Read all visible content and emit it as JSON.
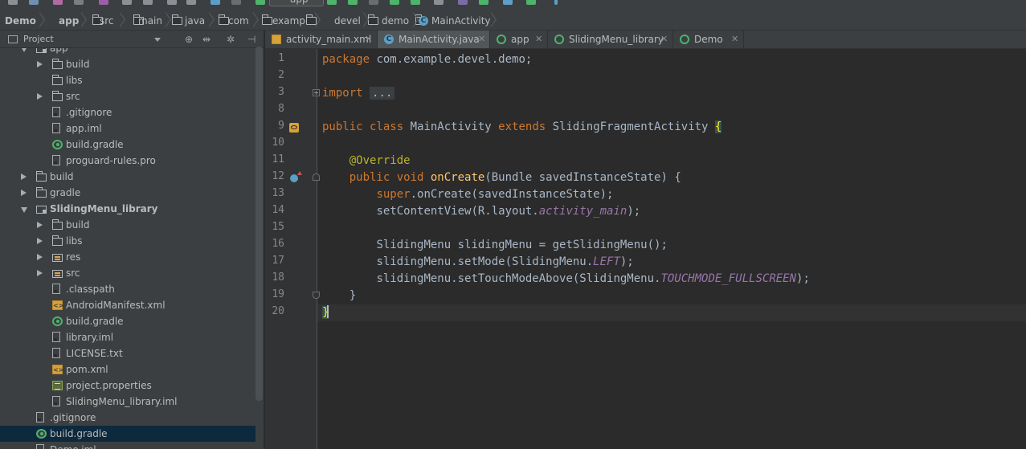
{
  "toolbar": {
    "run_config": "app"
  },
  "breadcrumbs": [
    "Demo",
    "app",
    "src",
    "main",
    "java",
    "com",
    "example",
    "devel",
    "demo",
    "MainActivity"
  ],
  "project_panel": {
    "title": "Project"
  },
  "tree": [
    {
      "label": "app",
      "type": "modfolder",
      "depth": 1,
      "arrow": "open"
    },
    {
      "label": "build",
      "type": "folder",
      "depth": 2,
      "arrow": "closed"
    },
    {
      "label": "libs",
      "type": "folder",
      "depth": 2,
      "arrow": "none"
    },
    {
      "label": "src",
      "type": "folder",
      "depth": 2,
      "arrow": "closed"
    },
    {
      "label": ".gitignore",
      "type": "file",
      "depth": 2,
      "arrow": "none"
    },
    {
      "label": "app.iml",
      "type": "file",
      "depth": 2,
      "arrow": "none"
    },
    {
      "label": "build.gradle",
      "type": "gradle",
      "depth": 2,
      "arrow": "none"
    },
    {
      "label": "proguard-rules.pro",
      "type": "file",
      "depth": 2,
      "arrow": "none"
    },
    {
      "label": "build",
      "type": "folder",
      "depth": 1,
      "arrow": "closed"
    },
    {
      "label": "gradle",
      "type": "folder",
      "depth": 1,
      "arrow": "closed"
    },
    {
      "label": "SlidingMenu_library",
      "type": "modfolder",
      "depth": 1,
      "arrow": "open",
      "bold": true
    },
    {
      "label": "build",
      "type": "folder",
      "depth": 2,
      "arrow": "closed"
    },
    {
      "label": "libs",
      "type": "folder",
      "depth": 2,
      "arrow": "closed"
    },
    {
      "label": "res",
      "type": "resfolder",
      "depth": 2,
      "arrow": "closed"
    },
    {
      "label": "src",
      "type": "resfolder",
      "depth": 2,
      "arrow": "closed"
    },
    {
      "label": ".classpath",
      "type": "file",
      "depth": 2,
      "arrow": "none"
    },
    {
      "label": "AndroidManifest.xml",
      "type": "xml",
      "depth": 2,
      "arrow": "none"
    },
    {
      "label": "build.gradle",
      "type": "gradle",
      "depth": 2,
      "arrow": "none"
    },
    {
      "label": "library.iml",
      "type": "file",
      "depth": 2,
      "arrow": "none"
    },
    {
      "label": "LICENSE.txt",
      "type": "file",
      "depth": 2,
      "arrow": "none"
    },
    {
      "label": "pom.xml",
      "type": "xml",
      "depth": 2,
      "arrow": "none"
    },
    {
      "label": "project.properties",
      "type": "props",
      "depth": 2,
      "arrow": "none"
    },
    {
      "label": "SlidingMenu_library.iml",
      "type": "file",
      "depth": 2,
      "arrow": "none"
    },
    {
      "label": ".gitignore",
      "type": "file",
      "depth": 1,
      "arrow": "none"
    },
    {
      "label": "build.gradle",
      "type": "gradle",
      "depth": 1,
      "arrow": "none",
      "selected": true
    },
    {
      "label": "Demo.iml",
      "type": "file",
      "depth": 1,
      "arrow": "none"
    }
  ],
  "tabs": [
    {
      "label": "activity_main.xml",
      "icon": "xml",
      "active": false
    },
    {
      "label": "MainActivity.java",
      "icon": "class",
      "active": true
    },
    {
      "label": "app",
      "icon": "gradle",
      "active": false
    },
    {
      "label": "SlidingMenu_library",
      "icon": "gradle",
      "active": false
    },
    {
      "label": "Demo",
      "icon": "gradle",
      "active": false
    }
  ],
  "line_numbers": [
    "1",
    "2",
    "3",
    "8",
    "9",
    "10",
    "11",
    "12",
    "13",
    "14",
    "15",
    "16",
    "17",
    "18",
    "19",
    "20"
  ],
  "code": {
    "package_kw": "package",
    "package_name": " com.example.devel.demo;",
    "import_kw": "import",
    "import_fold": "...",
    "class_mods": "public class",
    "class_name": " MainActivity ",
    "extends_kw": "extends",
    "super_class": " SlidingFragmentActivity ",
    "open_brace": "{",
    "annotation": "@Override",
    "method_mods": "public void",
    "method_name": "onCreate",
    "method_params": "(Bundle savedInstanceState) {",
    "super_kw": "super",
    "super_call": ".onCreate(savedInstanceState);",
    "set_content_a": "setContentView(R.layout.",
    "set_content_field": "activity_main",
    "set_content_b": ");",
    "sliding_decl": "SlidingMenu slidingMenu = getSlidingMenu();",
    "set_mode_a": "slidingMenu.setMode(SlidingMenu.",
    "set_mode_field": "LEFT",
    "set_mode_b": ");",
    "touch_a": "slidingMenu.setTouchModeAbove(SlidingMenu.",
    "touch_field": "TOUCHMODE_FULLSCREEN",
    "touch_b": ");",
    "method_close": "}",
    "class_close": "}"
  }
}
